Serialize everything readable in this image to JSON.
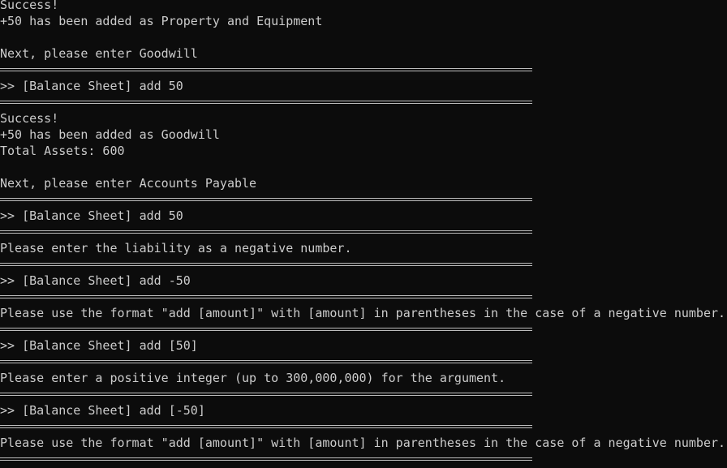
{
  "terminal": {
    "lines": [
      {
        "type": "text",
        "text": "Success!"
      },
      {
        "type": "text",
        "text": "+50 has been added as Property and Equipment"
      },
      {
        "type": "text",
        "text": ""
      },
      {
        "type": "text",
        "text": "Next, please enter Goodwill"
      },
      {
        "type": "separator",
        "text": "=========================================================================="
      },
      {
        "type": "prompt",
        "text": ">> [Balance Sheet] add 50"
      },
      {
        "type": "separator",
        "text": "=========================================================================="
      },
      {
        "type": "text",
        "text": "Success!"
      },
      {
        "type": "text",
        "text": "+50 has been added as Goodwill"
      },
      {
        "type": "text",
        "text": "Total Assets: 600"
      },
      {
        "type": "text",
        "text": ""
      },
      {
        "type": "text",
        "text": "Next, please enter Accounts Payable"
      },
      {
        "type": "separator",
        "text": "=========================================================================="
      },
      {
        "type": "prompt",
        "text": ">> [Balance Sheet] add 50"
      },
      {
        "type": "separator",
        "text": "=========================================================================="
      },
      {
        "type": "text",
        "text": "Please enter the liability as a negative number."
      },
      {
        "type": "separator",
        "text": "=========================================================================="
      },
      {
        "type": "prompt",
        "text": ">> [Balance Sheet] add -50"
      },
      {
        "type": "separator",
        "text": "=========================================================================="
      },
      {
        "type": "text",
        "text": "Please use the format \"add [amount]\" with [amount] in parentheses in the case of a negative number."
      },
      {
        "type": "separator",
        "text": "=========================================================================="
      },
      {
        "type": "prompt",
        "text": ">> [Balance Sheet] add [50]"
      },
      {
        "type": "separator",
        "text": "=========================================================================="
      },
      {
        "type": "text",
        "text": "Please enter a positive integer (up to 300,000,000) for the argument."
      },
      {
        "type": "separator",
        "text": "=========================================================================="
      },
      {
        "type": "prompt",
        "text": ">> [Balance Sheet] add [-50]"
      },
      {
        "type": "separator",
        "text": "=========================================================================="
      },
      {
        "type": "text",
        "text": "Please use the format \"add [amount]\" with [amount] in parentheses in the case of a negative number."
      },
      {
        "type": "separator",
        "text": "=========================================================================="
      }
    ],
    "colors": {
      "background": "#0c0c0c",
      "foreground": "#cccccc"
    }
  }
}
